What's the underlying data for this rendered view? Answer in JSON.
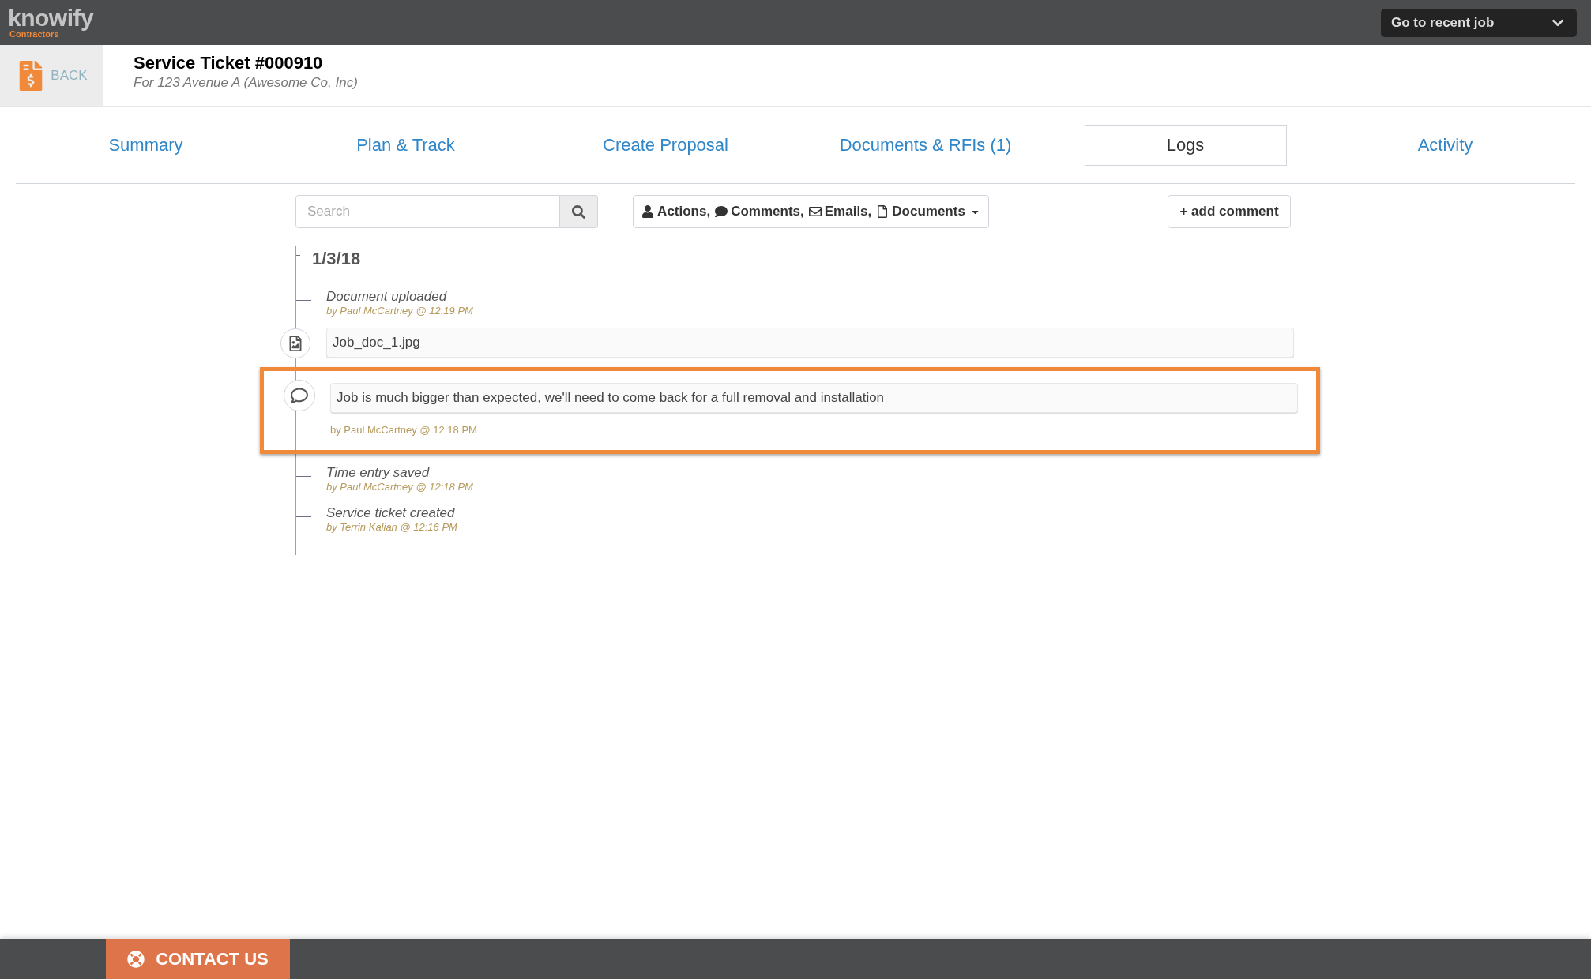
{
  "topbar": {
    "logo": {
      "wordmark": "knowify",
      "tagline": "Contractors"
    },
    "recent_job": "Go to recent job"
  },
  "header": {
    "back": "BACK",
    "title": "Service Ticket #000910",
    "subtitle": "For 123 Avenue A (Awesome Co, Inc)"
  },
  "tabs": [
    {
      "label": "Summary",
      "selected": false
    },
    {
      "label": "Plan & Track",
      "selected": false
    },
    {
      "label": "Create Proposal",
      "selected": false
    },
    {
      "label": "Documents & RFIs (1)",
      "selected": false
    },
    {
      "label": "Logs",
      "selected": true
    },
    {
      "label": "Activity",
      "selected": false
    }
  ],
  "toolbar": {
    "search": {
      "placeholder": "Search"
    },
    "filters": [
      {
        "kind": "user",
        "label": "Actions,"
      },
      {
        "kind": "comment",
        "label": "Comments,"
      },
      {
        "kind": "email",
        "label": "Emails,"
      },
      {
        "kind": "document",
        "label": "Documents"
      }
    ],
    "add_comment": "+ add comment"
  },
  "log": {
    "date": "1/3/18",
    "entries": [
      {
        "kind": "event",
        "title": "Document uploaded",
        "by": "by Paul McCartney @ 12:19 PM"
      },
      {
        "kind": "file",
        "name": "Job_doc_1.jpg"
      },
      {
        "kind": "comment",
        "text": "Job is much bigger than expected, we'll need to come back for a full removal and installation",
        "by": "by Paul McCartney @ 12:18 PM",
        "highlighted": true
      },
      {
        "kind": "event",
        "title": "Time entry saved",
        "by": "by Paul McCartney @ 12:18 PM"
      },
      {
        "kind": "event",
        "title": "Service ticket created",
        "by": "by Terrin Kalian @ 12:16 PM"
      }
    ]
  },
  "footer": {
    "contact": "CONTACT US"
  }
}
